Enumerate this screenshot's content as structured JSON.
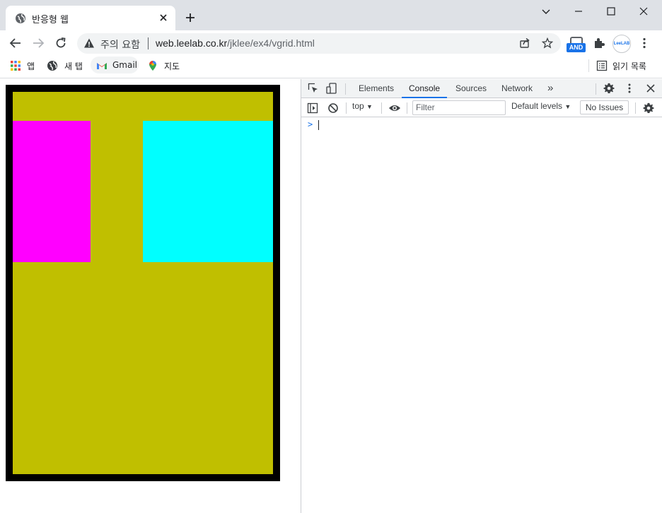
{
  "window": {
    "tab_title": "반응형 웹",
    "controls": [
      "minimize",
      "maximize",
      "close"
    ]
  },
  "toolbar": {
    "security_label": "주의 요함",
    "url_host": "web.leelab.co.kr",
    "url_path": "/jklee/ex4/vgrid.html",
    "ext_and_label": "AND",
    "ext_leelab_label": "LeeLAB"
  },
  "bookmarks": {
    "items": [
      {
        "label": "앱",
        "icon": "apps-grid-icon"
      },
      {
        "label": "새 탭",
        "icon": "globe-icon"
      },
      {
        "label": "Gmail",
        "icon": "gmail-icon"
      },
      {
        "label": "지도",
        "icon": "maps-pin-icon"
      }
    ],
    "reading_list": "읽기 목록"
  },
  "page": {
    "colors": {
      "border": "#000000",
      "background": "#c0bf00",
      "box_left": "#ff00ff",
      "box_right": "#00ffff"
    }
  },
  "devtools": {
    "tabs": [
      "Elements",
      "Console",
      "Sources",
      "Network"
    ],
    "active_tab": "Console",
    "more_tabs": "»",
    "context": "top",
    "filter_placeholder": "Filter",
    "levels": "Default levels",
    "issues": "No Issues",
    "prompt": ">"
  }
}
